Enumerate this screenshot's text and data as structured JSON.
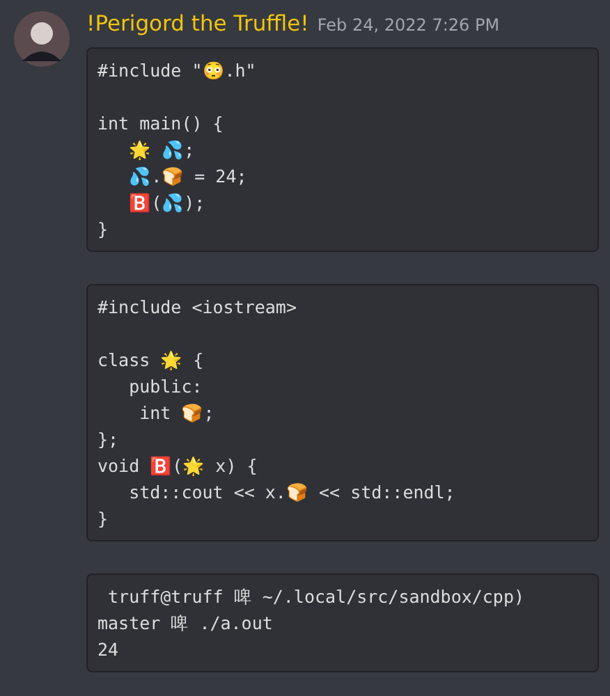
{
  "message": {
    "author": "!Perigord the Truffle!",
    "timestamp": "Feb 24, 2022 7:26 PM",
    "code_blocks": [
      {
        "code": "#include \"😳.h\"\n\nint main() {\n   🌟 💦;\n   💦.🍞 = 24;\n   🅱️(💦);\n}"
      },
      {
        "code": "#include <iostream>\n\nclass 🌟 {\n   public:\n    int 🍞;\n};\nvoid 🅱️(🌟 x) {\n   std::cout << x.🍞 << std::endl;\n}"
      },
      {
        "code": " truff@truff 啤 ~/.local/src/sandbox/cpp)\nmaster 啤 ./a.out\n24"
      }
    ]
  }
}
